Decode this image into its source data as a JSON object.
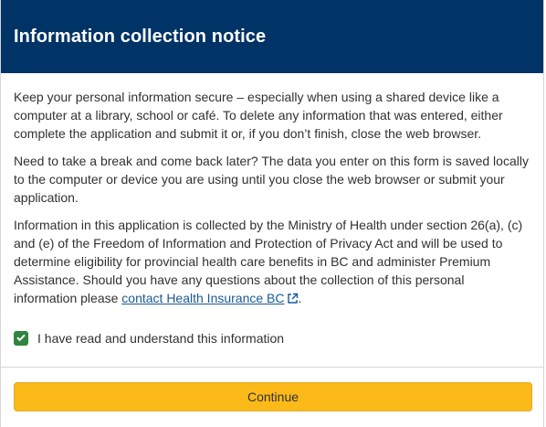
{
  "modal": {
    "title": "Information collection notice",
    "paragraphs": {
      "p1": "Keep your personal information secure – especially when using a shared device like a computer at a library, school or café. To delete any information that was entered, either complete the application and submit it or, if you don’t finish, close the web browser.",
      "p2": "Need to take a break and come back later? The data you enter on this form is saved locally to the computer or device you are using until you close the web browser or submit your application.",
      "p3_text": "Information in this application is collected by the Ministry of Health under section 26(a), (c) and (e) of the Freedom of Information and Protection of Privacy Act and will be used to determine eligibility for provincial health care benefits in BC and administer Premium Assistance. Should you have any questions about the collection of this personal information please ",
      "p3_link": "contact Health Insurance BC",
      "p3_end": "."
    },
    "checkbox": {
      "label": "I have read and understand this information",
      "checked": true
    },
    "continue_label": "Continue"
  },
  "colors": {
    "header_bg": "#003366",
    "button_bg": "#fcba19",
    "checkbox_bg": "#2e8540",
    "link": "#1a5a96"
  },
  "icons": {
    "external_link": "external-link-icon",
    "checkmark": "checkmark-icon"
  }
}
